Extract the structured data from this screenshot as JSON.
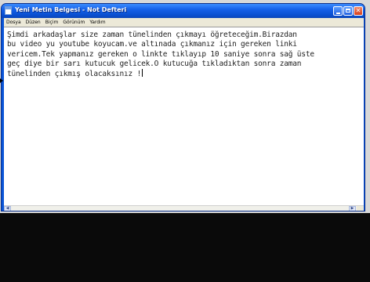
{
  "window": {
    "title": "Yeni Metin Belgesi - Not Defteri"
  },
  "menu": {
    "items": [
      "Dosya",
      "Düzen",
      "Biçim",
      "Görünüm",
      "Yardım"
    ]
  },
  "editor": {
    "lines": [
      "Şimdi arkadaşlar size zaman tünelinden çıkmayı öğreteceğim.Birazdan",
      "bu video yu youtube koyucam.ve altınada çıkmanız için gereken linki",
      "vericem.Tek yapmanız gereken o linkte tıklayıp 10 saniye sonra sağ üste",
      "geç diye bir sarı kutucuk gelicek.O kutucuğa tıkladıktan sonra zaman",
      "tünelinden çıkmış olacaksınız !"
    ]
  },
  "titlebar_buttons": {
    "close_glyph": "✕"
  },
  "scrollbar": {
    "left_arrow": "◀",
    "right_arrow": "▶"
  },
  "colors": {
    "titlebar_blue": "#0a55d8",
    "menu_bg": "#ece9d8",
    "close_red": "#d8401c"
  }
}
